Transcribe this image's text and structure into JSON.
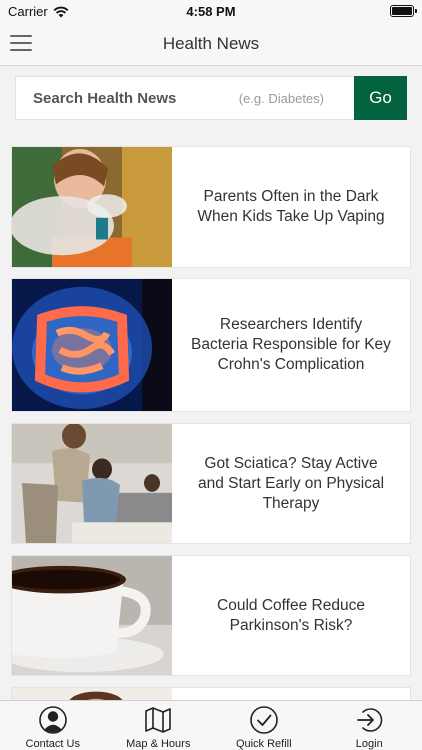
{
  "status_bar": {
    "carrier": "Carrier",
    "time": "4:58 PM"
  },
  "nav": {
    "title": "Health News"
  },
  "search": {
    "label": "Search Health News",
    "hint": "(e.g. Diabetes)",
    "button": "Go"
  },
  "articles": [
    {
      "title": "Parents Often in the Dark When Kids Take Up Vaping"
    },
    {
      "title": "Researchers Identify Bacteria Responsible for Key Crohn's Complication"
    },
    {
      "title": "Got Sciatica? Stay Active and Start Early on Physical Therapy"
    },
    {
      "title": "Could Coffee Reduce Parkinson's Risk?"
    }
  ],
  "tabs": [
    {
      "label": "Contact Us",
      "icon": "person-icon"
    },
    {
      "label": "Map & Hours",
      "icon": "map-icon"
    },
    {
      "label": "Quick Refill",
      "icon": "checkmark-icon"
    },
    {
      "label": "Login",
      "icon": "login-icon"
    }
  ]
}
